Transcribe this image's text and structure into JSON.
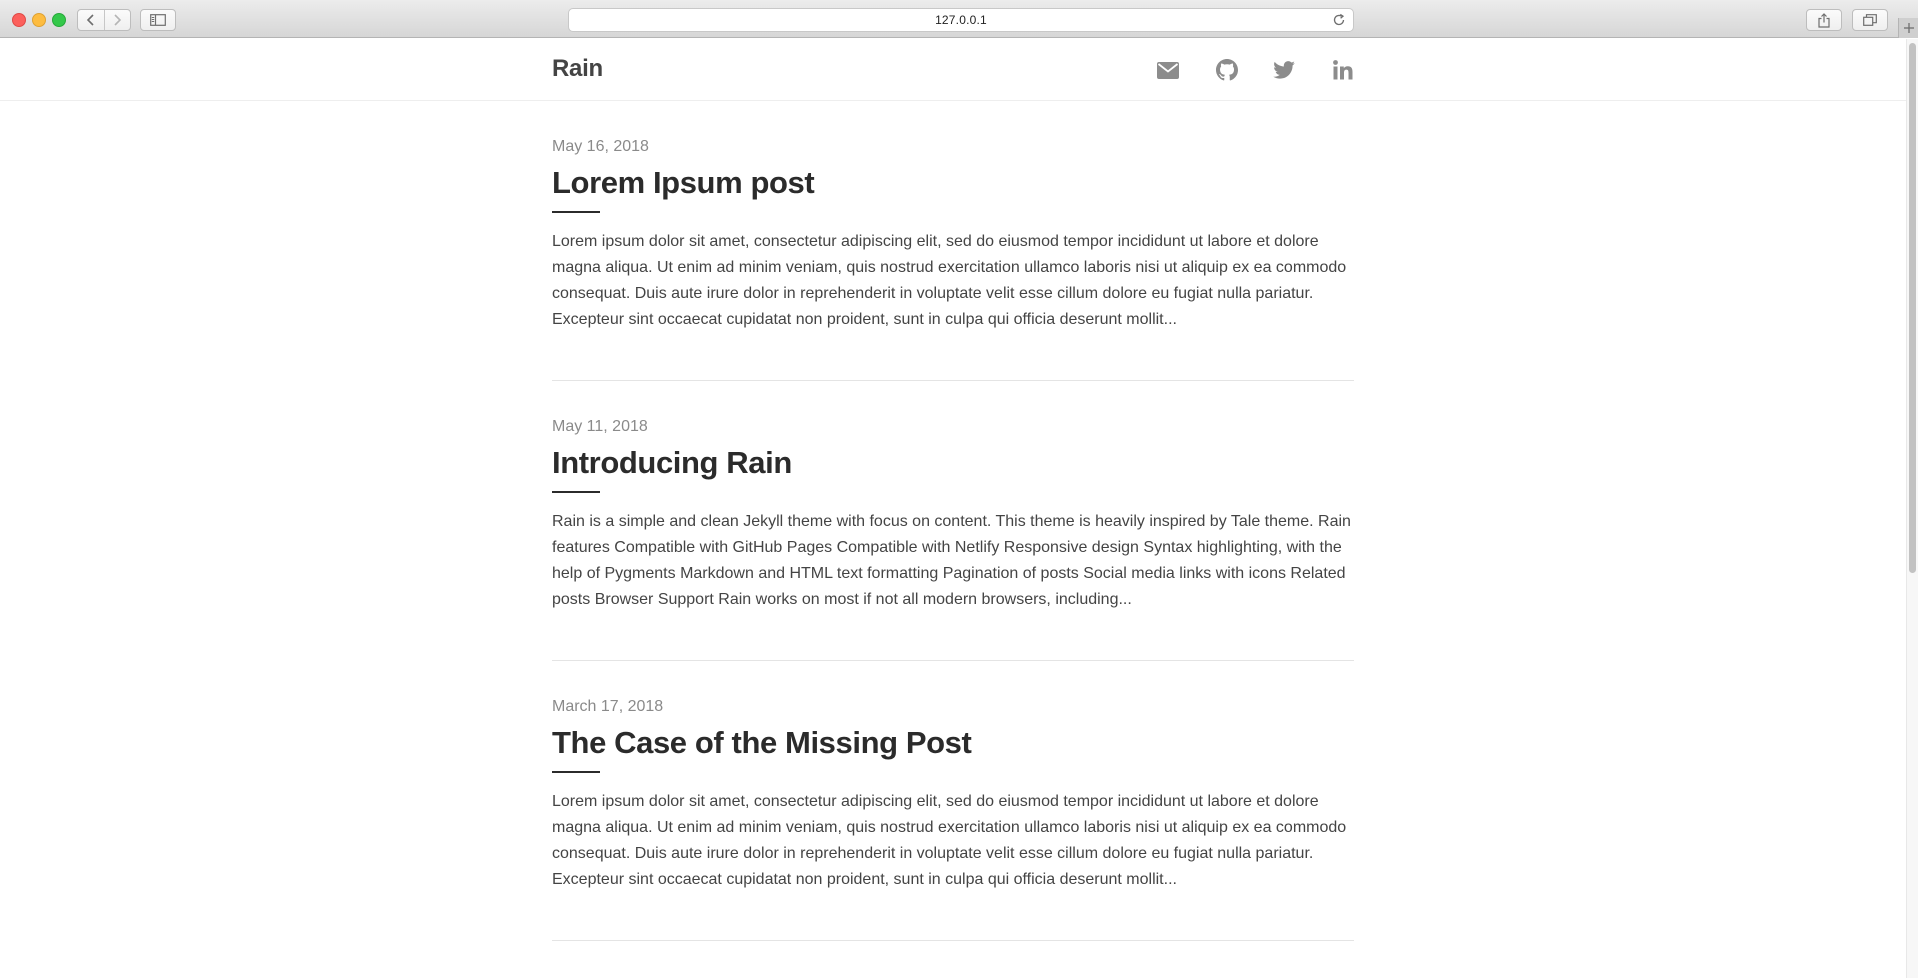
{
  "browser": {
    "url": "127.0.0.1",
    "icons": [
      "back-icon",
      "forward-icon",
      "sidebar-icon",
      "reload-icon",
      "share-icon",
      "tabs-icon",
      "new-tab-icon"
    ]
  },
  "site": {
    "title": "Rain",
    "social_icons": [
      "mail-icon",
      "github-icon",
      "twitter-icon",
      "linkedin-icon"
    ]
  },
  "posts": [
    {
      "date": "May 16, 2018",
      "title": "Lorem Ipsum post",
      "excerpt": "Lorem ipsum dolor sit amet, consectetur adipiscing elit, sed do eiusmod tempor incididunt ut labore et dolore magna aliqua. Ut enim ad minim veniam, quis nostrud exercitation ullamco laboris nisi ut aliquip ex ea commodo consequat. Duis aute irure dolor in reprehenderit in voluptate velit esse cillum dolore eu fugiat nulla pariatur. Excepteur sint occaecat cupidatat non proident, sunt in culpa qui officia deserunt mollit..."
    },
    {
      "date": "May 11, 2018",
      "title": "Introducing Rain",
      "excerpt": "Rain is a simple and clean Jekyll theme with focus on content. This theme is heavily inspired by Tale theme. Rain features Compatible with GitHub Pages Compatible with Netlify Responsive design Syntax highlighting, with the help of Pygments Markdown and HTML text formatting Pagination of posts Social media links with icons Related posts Browser Support Rain works on most if not all modern browsers, including..."
    },
    {
      "date": "March 17, 2018",
      "title": "The Case of the Missing Post",
      "excerpt": "Lorem ipsum dolor sit amet, consectetur adipiscing elit, sed do eiusmod tempor incididunt ut labore et dolore magna aliqua. Ut enim ad minim veniam, quis nostrud exercitation ullamco laboris nisi ut aliquip ex ea commodo consequat. Duis aute irure dolor in reprehenderit in voluptate velit esse cillum dolore eu fugiat nulla pariatur. Excepteur sint occaecat cupidatat non proident, sunt in culpa qui officia deserunt mollit..."
    }
  ],
  "colors": {
    "title": "#2b2b2b",
    "date": "#8a8a8a",
    "icon": "#8c8c8c",
    "close": "#fc605c",
    "minimize": "#fdbc40",
    "zoom": "#34c84a"
  }
}
